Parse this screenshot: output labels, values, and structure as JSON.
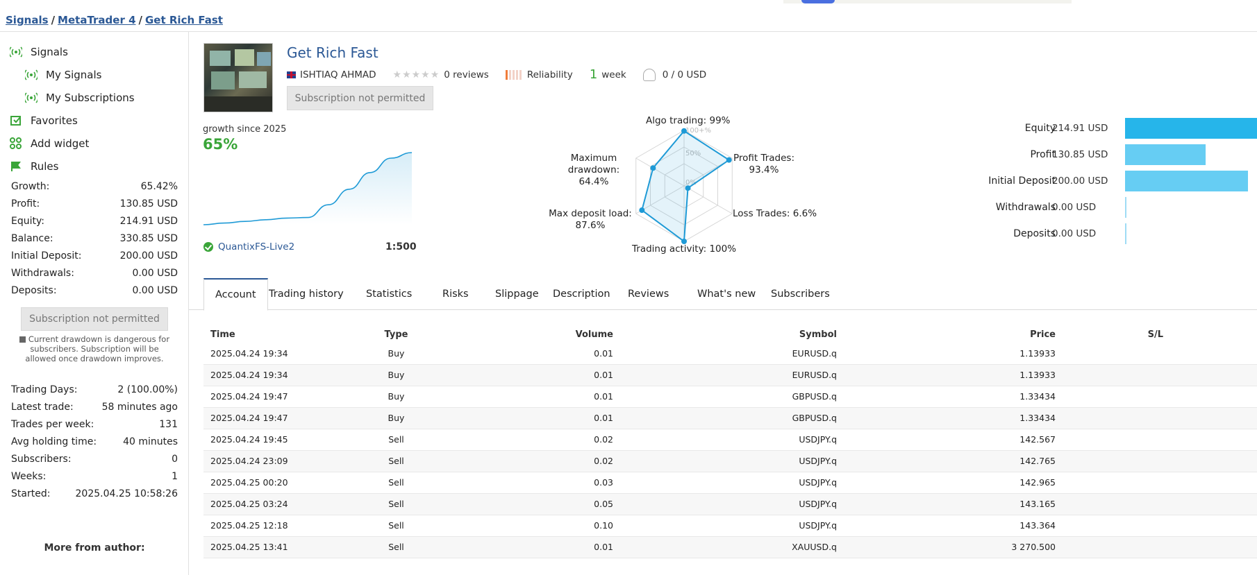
{
  "breadcrumb": {
    "items": [
      "Signals",
      "MetaTrader 4",
      "Get Rich Fast"
    ],
    "separator": "/"
  },
  "sidebar": {
    "nav": [
      {
        "label": "Signals",
        "icon": "signal-antenna-icon",
        "sub": false
      },
      {
        "label": "My Signals",
        "icon": "signal-antenna-icon",
        "sub": true
      },
      {
        "label": "My Subscriptions",
        "icon": "subscription-antenna-icon",
        "sub": true
      },
      {
        "label": "Favorites",
        "icon": "favorites-icon",
        "sub": false
      },
      {
        "label": "Add widget",
        "icon": "widget-icon",
        "sub": false
      },
      {
        "label": "Rules",
        "icon": "rules-flag-icon",
        "sub": false
      }
    ],
    "stats1": [
      {
        "label": "Growth:",
        "value": "65.42%"
      },
      {
        "label": "Profit:",
        "value": "130.85 USD"
      },
      {
        "label": "Equity:",
        "value": "214.91 USD"
      },
      {
        "label": "Balance:",
        "value": "330.85 USD"
      },
      {
        "label": "Initial Deposit:",
        "value": "200.00 USD"
      },
      {
        "label": "Withdrawals:",
        "value": "0.00 USD"
      },
      {
        "label": "Deposits:",
        "value": "0.00 USD"
      }
    ],
    "subscribe_label": "Subscription not permitted",
    "warning": "Current drawdown is dangerous for subscribers. Subscription will be allowed once drawdown improves.",
    "stats2": [
      {
        "label": "Trading Days:",
        "value": "2 (100.00%)"
      },
      {
        "label": "Latest trade:",
        "value": "58 minutes ago"
      },
      {
        "label": "Trades per week:",
        "value": "131"
      },
      {
        "label": "Avg holding time:",
        "value": "40 minutes"
      },
      {
        "label": "Subscribers:",
        "value": "0"
      },
      {
        "label": "Weeks:",
        "value": "1"
      },
      {
        "label": "Started:",
        "value": "2025.04.25 10:58:26"
      }
    ],
    "more_from_author": "More from author:"
  },
  "signal": {
    "title": "Get Rich Fast",
    "author": "ISHTIAQ AHMAD",
    "reviews": "0 reviews",
    "reliability_label": "Reliability",
    "reliability_level": 0.2,
    "weeks_num": "1",
    "weeks_unit": "week",
    "subscribers_price": "0 / 0 USD",
    "subscribe_label": "Subscription not permitted",
    "growth_label": "growth since 2025",
    "growth_value": "65%",
    "broker": "QuantixFS-Live2",
    "leverage": "1:500"
  },
  "growth_chart": {
    "type": "area",
    "x": [
      0,
      1,
      2,
      3,
      4,
      5,
      6,
      7,
      8,
      9,
      10
    ],
    "y": [
      0,
      1.5,
      3,
      4.5,
      6,
      6.5,
      18,
      32,
      47,
      60,
      65
    ],
    "ylim": [
      0,
      75
    ],
    "color": "#1e9ad6"
  },
  "chart_data": {
    "type": "radar",
    "axes": [
      {
        "label": "Algo trading: 99%",
        "value": 99
      },
      {
        "label": "Profit Trades: 93.4%",
        "value": 93.4
      },
      {
        "label": "Loss Trades: 6.6%",
        "value": 6.6
      },
      {
        "label": "Trading activity: 100%",
        "value": 100
      },
      {
        "label": "Max deposit load: 87.6%",
        "value": 87.6
      },
      {
        "label": "Maximum drawdown: 64.4%",
        "value": 64.4
      }
    ],
    "rings": [
      "100+%",
      "50%",
      "0%"
    ],
    "ylim": [
      0,
      100
    ],
    "color": "#1e9ad6"
  },
  "money_bars": {
    "max": 214.91,
    "items": [
      {
        "label": "Equity",
        "display": "214.91 USD",
        "value": 214.91,
        "color": "#26b5ea"
      },
      {
        "label": "Profit",
        "display": "130.85 USD",
        "value": 130.85,
        "color": "#66cdf3"
      },
      {
        "label": "Initial Deposit",
        "display": "200.00 USD",
        "value": 200.0,
        "color": "#66cdf3"
      },
      {
        "label": "Withdrawals",
        "display": "0.00 USD",
        "value": 0,
        "color": "#9fdcf5"
      },
      {
        "label": "Deposits",
        "display": "0.00 USD",
        "value": 0,
        "color": "#9fdcf5"
      }
    ]
  },
  "tabs": [
    "Account",
    "Trading history",
    "Statistics",
    "Risks",
    "Slippage",
    "Description",
    "Reviews",
    "What's new",
    "Subscribers"
  ],
  "table": {
    "headers": [
      "Time",
      "Type",
      "Volume",
      "Symbol",
      "Price",
      "S/L"
    ],
    "rows": [
      [
        "2025.04.24 19:34",
        "Buy",
        "0.01",
        "EURUSD.q",
        "1.13933"
      ],
      [
        "2025.04.24 19:34",
        "Buy",
        "0.01",
        "EURUSD.q",
        "1.13933"
      ],
      [
        "2025.04.24 19:47",
        "Buy",
        "0.01",
        "GBPUSD.q",
        "1.33434"
      ],
      [
        "2025.04.24 19:47",
        "Buy",
        "0.01",
        "GBPUSD.q",
        "1.33434"
      ],
      [
        "2025.04.24 19:45",
        "Sell",
        "0.02",
        "USDJPY.q",
        "142.567"
      ],
      [
        "2025.04.24 23:09",
        "Sell",
        "0.02",
        "USDJPY.q",
        "142.765"
      ],
      [
        "2025.04.25 00:20",
        "Sell",
        "0.03",
        "USDJPY.q",
        "142.965"
      ],
      [
        "2025.04.25 03:24",
        "Sell",
        "0.05",
        "USDJPY.q",
        "143.165"
      ],
      [
        "2025.04.25 12:18",
        "Sell",
        "0.10",
        "USDJPY.q",
        "143.364"
      ],
      [
        "2025.04.25 13:41",
        "Sell",
        "0.01",
        "XAUUSD.q",
        "3 270.500"
      ]
    ]
  }
}
